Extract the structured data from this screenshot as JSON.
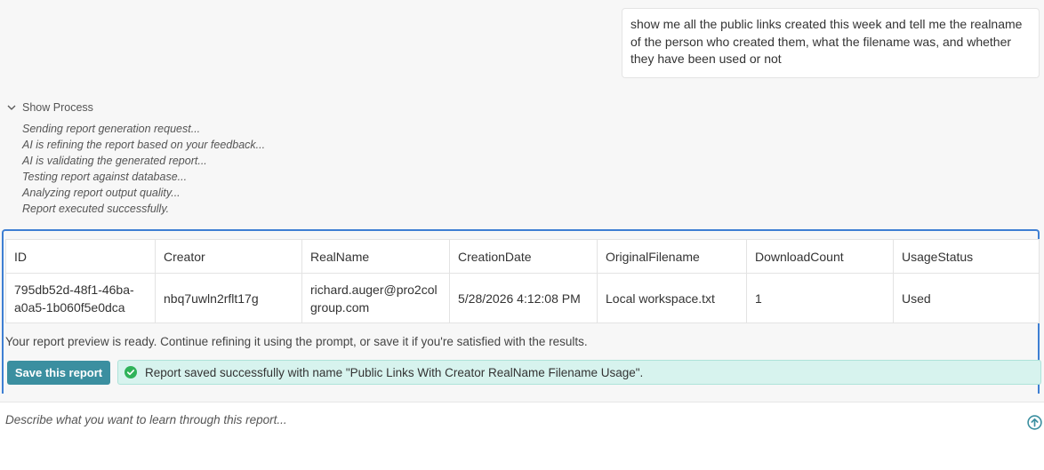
{
  "chat": {
    "user_message": "show me all the public links created this week and tell me the realname of the person who created them, what the filename was, and whether they have been used or not"
  },
  "process": {
    "toggle_label": "Show Process",
    "steps": [
      "Sending report generation request...",
      "AI is refining the report based on your feedback...",
      "AI is validating the generated report...",
      "Testing report against database...",
      "Analyzing report output quality...",
      "Report executed successfully."
    ]
  },
  "report": {
    "columns": [
      "ID",
      "Creator",
      "RealName",
      "CreationDate",
      "OriginalFilename",
      "DownloadCount",
      "UsageStatus"
    ],
    "rows": [
      {
        "id_line1": "795db52d-48f1-46ba-",
        "id_line2": "a0a5-1b060f5e0dca",
        "creator": "nbq7uwln2rflt17g",
        "realname_line1": "richard.auger@pro2col",
        "realname_line2": "group.com",
        "creation_date": "5/28/2026 4:12:08 PM",
        "original_filename": "Local workspace.txt",
        "download_count": "1",
        "usage_status": "Used"
      }
    ],
    "preview_note": "Your report preview is ready. Continue refining it using the prompt, or save it if you're satisfied with the results.",
    "save_label": "Save this report",
    "success_message": "Report saved successfully with name \"Public Links With Creator RealName Filename Usage\"."
  },
  "prompt": {
    "placeholder": "Describe what you want to learn through this report..."
  },
  "colors": {
    "panel_border": "#3e7fd3",
    "save_button": "#3b8fa0",
    "success_bg": "#d7f3ee",
    "success_icon": "#2fb35a",
    "send_icon": "#3b8fa0"
  },
  "icons": {
    "toggle": "chevron-down-icon",
    "success": "check-circle-icon",
    "send": "arrow-up-circle-icon"
  }
}
